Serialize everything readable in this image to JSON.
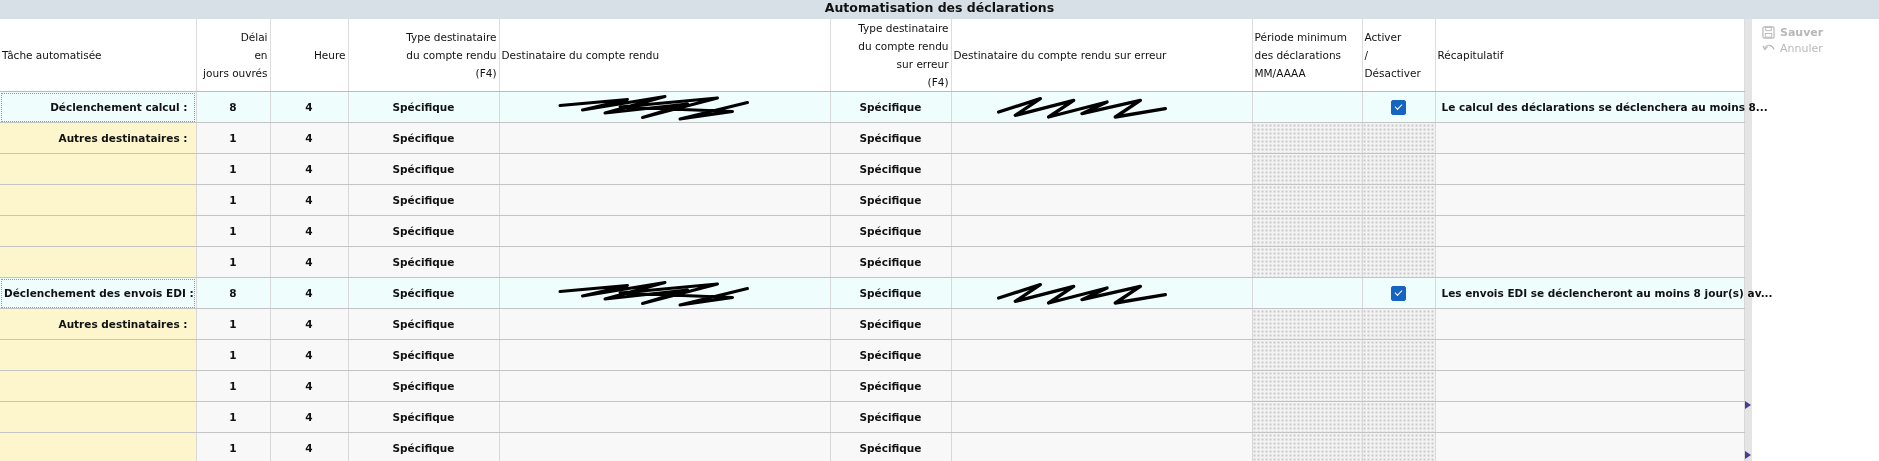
{
  "title": "Automatisation des déclarations",
  "columns": [
    "Tâche automatisée",
    "Délai\nen\njours ouvrés",
    "Heure",
    "Type destinataire\ndu compte rendu\n(F4)",
    "Destinataire du compte rendu",
    "Type destinataire\ndu compte rendu\nsur erreur\n(F4)",
    "Destinataire du compte rendu sur erreur",
    "Période minimum\ndes déclarations\nMM/AAAA",
    "Activer\n/\nDésactiver",
    "Récapitulatif"
  ],
  "rows": [
    {
      "kind": "main",
      "label": "Déclenchement calcul :",
      "delai": "8",
      "heure": "4",
      "type": "Spécifique",
      "redacted": true,
      "type_erreur": "Spécifique",
      "redacted_erreur": true,
      "active": true,
      "summary": "Le calcul des déclarations se déclenchera au moins 8..."
    },
    {
      "kind": "other",
      "label": "Autres destinataires :",
      "delai": "1",
      "heure": "4",
      "type": "Spécifique",
      "type_erreur": "Spécifique"
    },
    {
      "kind": "other",
      "delai": "1",
      "heure": "4",
      "type": "Spécifique",
      "type_erreur": "Spécifique"
    },
    {
      "kind": "other",
      "delai": "1",
      "heure": "4",
      "type": "Spécifique",
      "type_erreur": "Spécifique"
    },
    {
      "kind": "other",
      "delai": "1",
      "heure": "4",
      "type": "Spécifique",
      "type_erreur": "Spécifique"
    },
    {
      "kind": "other",
      "delai": "1",
      "heure": "4",
      "type": "Spécifique",
      "type_erreur": "Spécifique"
    },
    {
      "kind": "main",
      "label": "Déclenchement des envois EDI :",
      "delai": "8",
      "heure": "4",
      "type": "Spécifique",
      "redacted": true,
      "type_erreur": "Spécifique",
      "redacted_erreur": true,
      "active": true,
      "summary": "Les envois EDI se déclencheront au moins 8 jour(s) av..."
    },
    {
      "kind": "other",
      "label": "Autres destinataires :",
      "delai": "1",
      "heure": "4",
      "type": "Spécifique",
      "type_erreur": "Spécifique"
    },
    {
      "kind": "other",
      "delai": "1",
      "heure": "4",
      "type": "Spécifique",
      "type_erreur": "Spécifique"
    },
    {
      "kind": "other",
      "delai": "1",
      "heure": "4",
      "type": "Spécifique",
      "type_erreur": "Spécifique"
    },
    {
      "kind": "other",
      "delai": "1",
      "heure": "4",
      "type": "Spécifique",
      "type_erreur": "Spécifique"
    },
    {
      "kind": "other",
      "delai": "1",
      "heure": "4",
      "type": "Spécifique",
      "type_erreur": "Spécifique"
    }
  ],
  "actions": [
    {
      "kind": "save",
      "label": "Sauver",
      "disabled": true
    },
    {
      "kind": "cancel",
      "label": "Annuler",
      "disabled": true
    }
  ]
}
